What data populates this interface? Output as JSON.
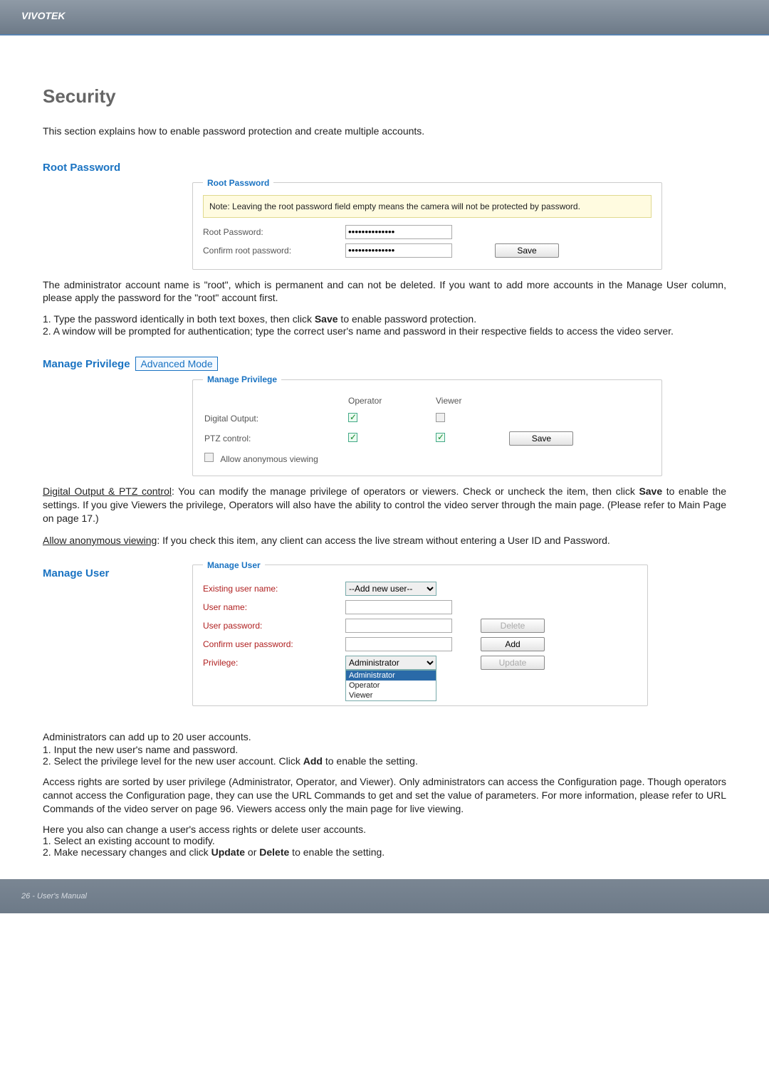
{
  "brand": "VIVOTEK",
  "page_title": "Security",
  "intro": "This section explains how to enable password protection and create multiple accounts.",
  "root_pw": {
    "heading": "Root Password",
    "legend": "Root Password",
    "note": "Note: Leaving the root password field empty means the camera will not be protected by password.",
    "label1": "Root Password:",
    "label2": "Confirm root password:",
    "value_mask": "••••••••••••••",
    "save": "Save"
  },
  "root_para": {
    "p1": "The administrator account name is \"root\", which is permanent and can not be deleted. If you want to add more accounts in the Manage User column, please apply the password for the \"root\" account first.",
    "p2_prefix": "1. Type the password identically in both text boxes, then click ",
    "p2_bold": "Save",
    "p2_suffix": " to enable password protection.",
    "p3": "2. A window will be prompted for authentication; type the correct user's name and password in their respective fields to access the video server."
  },
  "privilege": {
    "heading": "Manage Privilege",
    "mode": "Advanced Mode",
    "legend": "Manage Privilege",
    "col_op": "Operator",
    "col_vw": "Viewer",
    "row1": "Digital Output:",
    "row2": "PTZ control:",
    "anon": "Allow anonymous viewing",
    "save": "Save"
  },
  "priv_para": {
    "t1_u": "Digital Output & PTZ control",
    "t1_a": ": You can modify the manage privilege of operators or viewers. Check or uncheck the item, then click ",
    "t1_b": "Save",
    "t1_c": " to enable the settings. If you give Viewers the privilege, Operators will also have the ability to control the video server through the main page. (Please refer to Main Page on page 17.)",
    "t2_u": "Allow anonymous viewing",
    "t2": ": If you check this item, any client can access the live stream without entering a User ID and Password."
  },
  "user": {
    "heading": "Manage User",
    "legend": "Manage User",
    "existing": "Existing user name:",
    "existing_opt": "--Add new user--",
    "uname": "User name:",
    "upass": "User password:",
    "ucpass": "Confirm user password:",
    "priv": "Privilege:",
    "priv_sel": "Administrator",
    "opts": [
      "Administrator",
      "Operator",
      "Viewer"
    ],
    "delete": "Delete",
    "add": "Add",
    "update": "Update"
  },
  "user_para": {
    "a": "Administrators can add up to 20 user accounts.",
    "b": "1. Input the new user's name and password.",
    "c_pre": "2. Select the privilege level for the new user account. Click ",
    "c_b": "Add",
    "c_suf": " to enable the setting.",
    "d": "Access rights are sorted by user privilege (Administrator, Operator, and Viewer). Only administrators can access the Configuration page. Though operators cannot access the Configuration page, they can use the URL Commands to get and set the value of parameters. For more information, please refer to URL Commands of the video server on page 96. Viewers access only the main page for live viewing.",
    "e": "Here you also can change a user's access rights or delete user accounts.",
    "f": "1. Select an existing account to modify.",
    "g_pre": "2. Make necessary changes and click ",
    "g_b1": "Update",
    "g_mid": " or ",
    "g_b2": "Delete",
    "g_suf": " to enable the setting."
  },
  "footer": "26 - User's Manual"
}
